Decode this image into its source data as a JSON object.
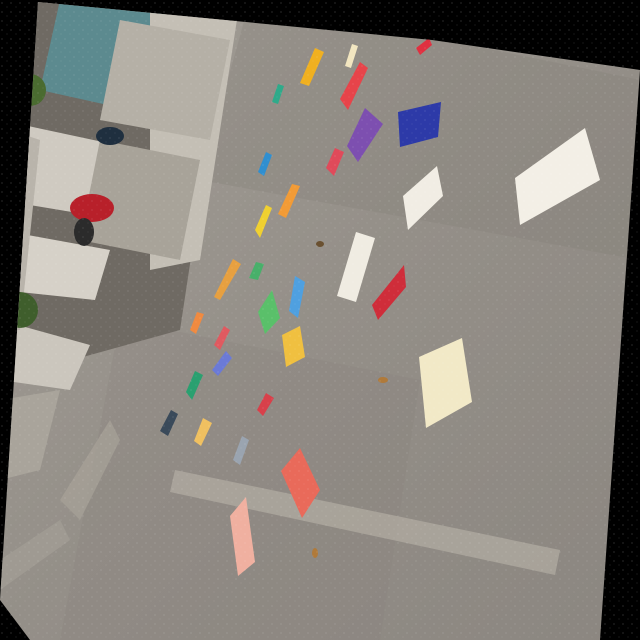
{
  "scene": {
    "kind": "photo",
    "colors": {
      "background": "#000000",
      "ground": "#9b9690",
      "ground_dark": "#7f7a74",
      "building": "#6f6a63",
      "pillar": "#c9c4bb",
      "glass": "#5c8a8f",
      "motorbike": "#b8202a",
      "plant": "#3f5e2c"
    },
    "objects": [
      {
        "name": "concrete-ground",
        "label": ""
      },
      {
        "name": "scattered-flyers",
        "label": ""
      },
      {
        "name": "building-arcade",
        "label": ""
      },
      {
        "name": "parked-motorbike",
        "label": ""
      }
    ]
  }
}
